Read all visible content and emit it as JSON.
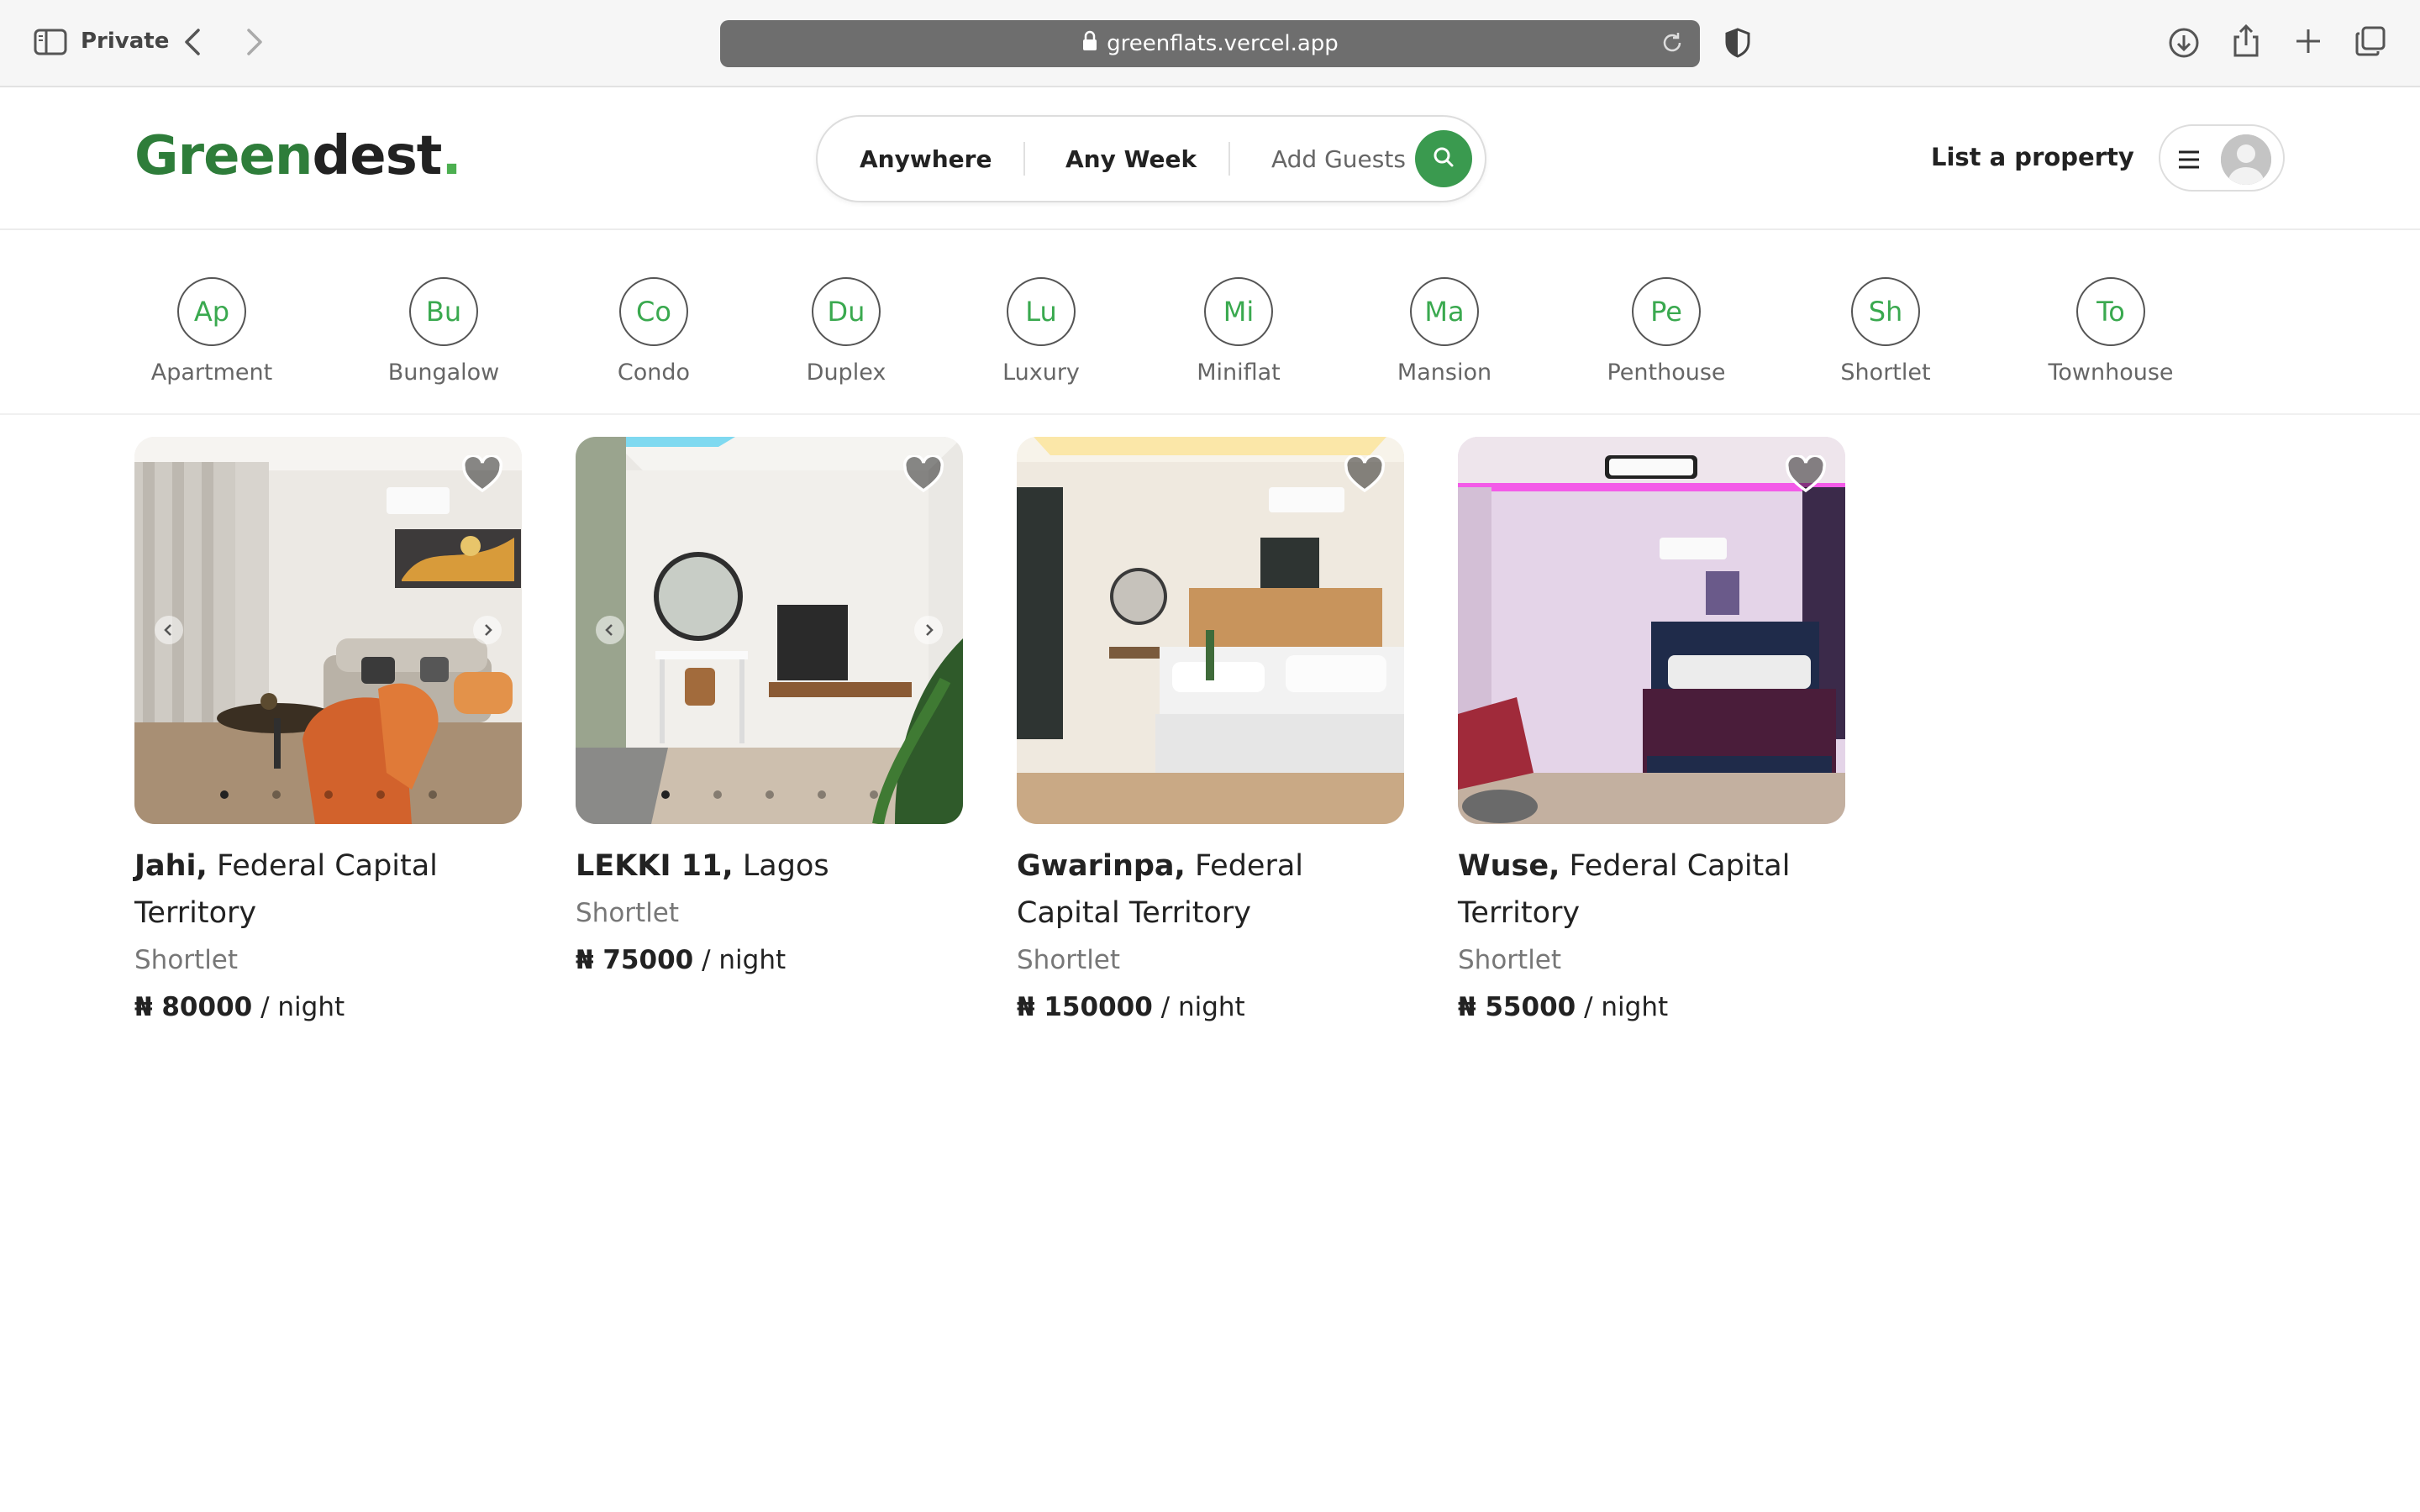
{
  "browser": {
    "private_label": "Private",
    "url": "greenflats.vercel.app"
  },
  "header": {
    "logo_green": "Green",
    "logo_rest": "dest",
    "logo_dot": ".",
    "search": {
      "location": "Anywhere",
      "week": "Any Week",
      "guests": "Add Guests"
    },
    "list_property": "List a property"
  },
  "categories": [
    {
      "abbr": "Ap",
      "label": "Apartment"
    },
    {
      "abbr": "Bu",
      "label": "Bungalow"
    },
    {
      "abbr": "Co",
      "label": "Condo"
    },
    {
      "abbr": "Du",
      "label": "Duplex"
    },
    {
      "abbr": "Lu",
      "label": "Luxury"
    },
    {
      "abbr": "Mi",
      "label": "Miniflat"
    },
    {
      "abbr": "Ma",
      "label": "Mansion"
    },
    {
      "abbr": "Pe",
      "label": "Penthouse"
    },
    {
      "abbr": "Sh",
      "label": "Shortlet"
    },
    {
      "abbr": "To",
      "label": "Townhouse"
    }
  ],
  "listings": [
    {
      "area": "Jahi,",
      "city": "Federal Capital Territory",
      "type": "Shortlet",
      "price": "₦ 80000",
      "unit": "/ night"
    },
    {
      "area": "LEKKI 11,",
      "city": "Lagos",
      "type": "Shortlet",
      "price": "₦ 75000",
      "unit": "/ night"
    },
    {
      "area": "Gwarinpa,",
      "city": "Federal Capital Territory",
      "type": "Shortlet",
      "price": "₦ 150000",
      "unit": "/ night"
    },
    {
      "area": "Wuse,",
      "city": "Federal Capital Territory",
      "type": "Shortlet",
      "price": "₦ 55000",
      "unit": "/ night"
    }
  ],
  "colors": {
    "brand_green": "#2e7d3a",
    "accent_green": "#3a9a4f"
  }
}
